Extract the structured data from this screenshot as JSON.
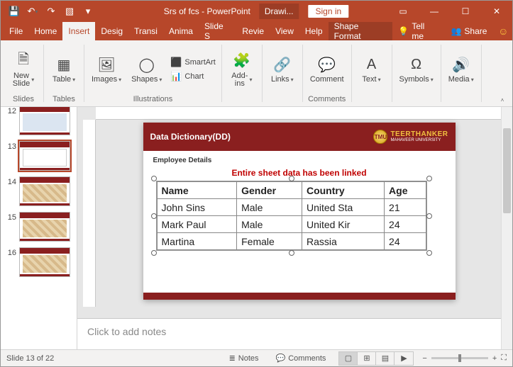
{
  "titlebar": {
    "doc_title": "Srs of fcs  -  PowerPoint",
    "context_tab": "Drawi...",
    "signin": "Sign in"
  },
  "menu": {
    "file": "File",
    "home": "Home",
    "insert": "Insert",
    "design": "Desig",
    "transitions": "Transi",
    "animations": "Anima",
    "slideshow": "Slide S",
    "review": "Revie",
    "view": "View",
    "help": "Help",
    "shape_format": "Shape Format",
    "tell_me": "Tell me",
    "share": "Share"
  },
  "ribbon": {
    "new_slide": "New\nSlide",
    "table": "Table",
    "images": "Images",
    "shapes": "Shapes",
    "smartart": "SmartArt",
    "chart": "Chart",
    "addins": "Add-\nins",
    "links": "Links",
    "comment": "Comment",
    "text": "Text",
    "symbols": "Symbols",
    "media": "Media",
    "grp_slides": "Slides",
    "grp_tables": "Tables",
    "grp_illustrations": "Illustrations",
    "grp_comments": "Comments"
  },
  "thumbs": {
    "n12": "12",
    "n13": "13",
    "n14": "14",
    "n15": "15",
    "n16": "16"
  },
  "slide": {
    "title": "Data Dictionary(DD)",
    "logo_main": "TEERTHANKER",
    "logo_sub": "MAHAVEER UNIVERSITY",
    "logo_badge": "TMU",
    "subtitle": "Employee Details",
    "note": "Entire sheet data has been linked",
    "table": {
      "h1": "Name",
      "h2": "Gender",
      "h3": "Country",
      "h4": "Age",
      "r1c1": "John Sins",
      "r1c2": "Male",
      "r1c3": "United Sta",
      "r1c4": "21",
      "r2c1": "Mark Paul",
      "r2c2": "Male",
      "r2c3": "United Kir",
      "r2c4": "24",
      "r3c1": "Martina",
      "r3c2": "Female",
      "r3c3": "Rassia",
      "r3c4": "24"
    }
  },
  "notes_placeholder": "Click to add notes",
  "status": {
    "slide_of": "Slide 13 of 22",
    "notes": "Notes",
    "comments": "Comments",
    "zoom_out": "−",
    "zoom_in": "+"
  }
}
